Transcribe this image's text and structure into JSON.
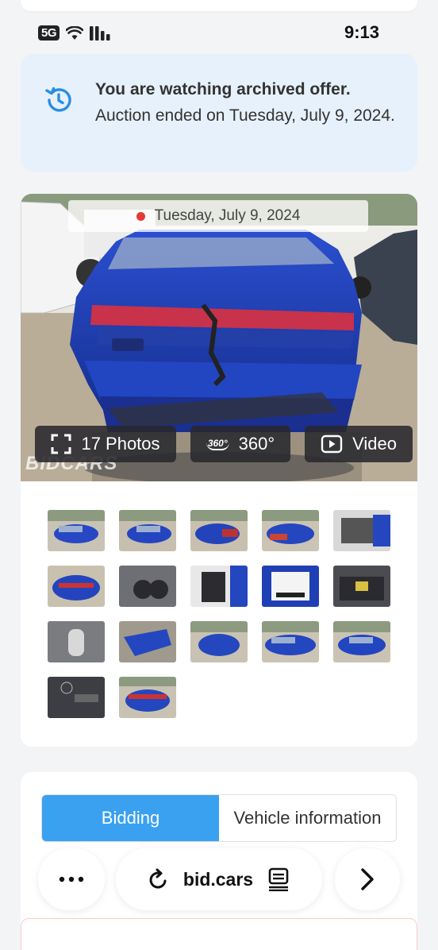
{
  "status_bar": {
    "network_badge": "5G",
    "time": "9:13",
    "wifi_icon": "wifi-icon",
    "signal_icon": "signal-icon"
  },
  "notice": {
    "icon": "history-icon",
    "title": "You are watching archived offer.",
    "body": "Auction ended on Tuesday, July 9, 2024."
  },
  "gallery": {
    "date": "Tuesday, July 9, 2024",
    "photos_label": "17 Photos",
    "view360_label": "360°",
    "view360_icon_text": "360°",
    "video_label": "Video",
    "watermark": "BIDCARS",
    "thumbnail_count": 17,
    "colors": {
      "car_blue": "#1f3fb5",
      "button_bg": "#28282d",
      "accent_red": "#e53935"
    }
  },
  "tabs": {
    "items": [
      {
        "label": "Bidding",
        "active": true
      },
      {
        "label": "Vehicle information",
        "active": false
      }
    ],
    "active_color": "#3aa0f0"
  },
  "browser": {
    "menu_icon": "more-dots-icon",
    "reload_icon": "reload-icon",
    "url": "bid.cars",
    "reader_icon": "reader-icon",
    "forward_icon": "chevron-right-icon"
  }
}
